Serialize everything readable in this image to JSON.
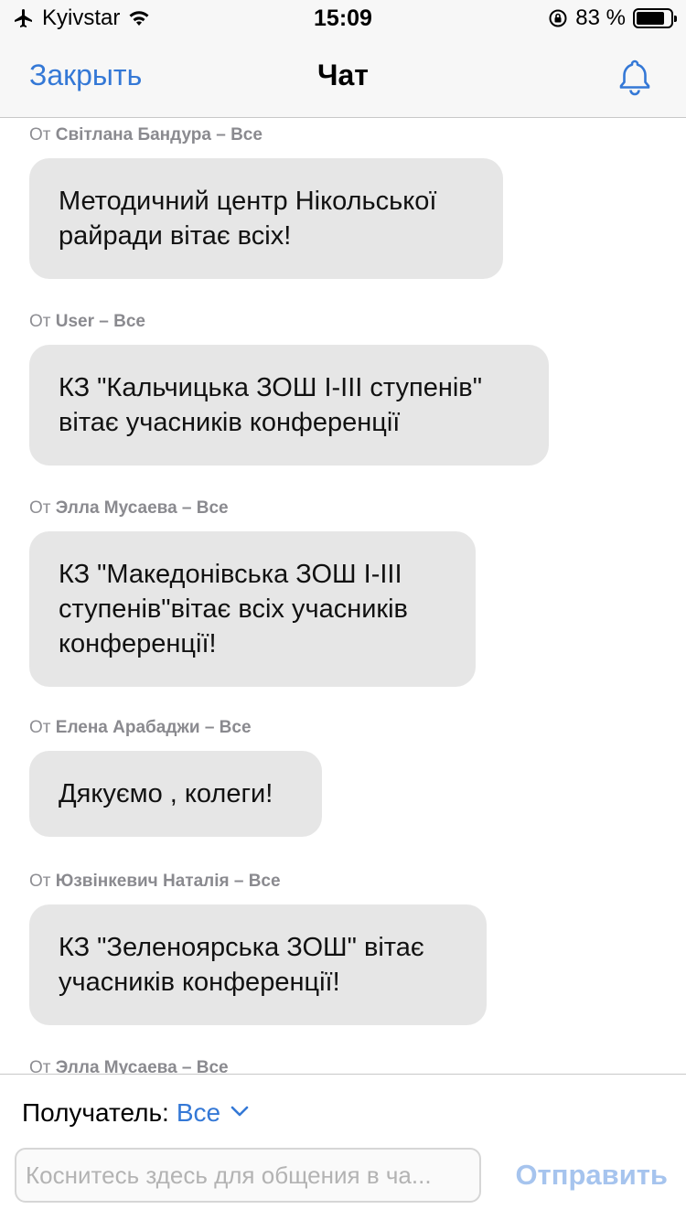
{
  "status_bar": {
    "carrier": "Kyivstar",
    "time": "15:09",
    "battery": "83 %",
    "battery_level": 0.83,
    "icons": [
      "airplane-icon",
      "wifi-icon",
      "orientation-lock-icon",
      "battery-icon"
    ]
  },
  "nav": {
    "close_label": "Закрыть",
    "title": "Чат",
    "bell_icon": "bell-icon"
  },
  "messages": [
    {
      "from_prefix": "От",
      "sender": "Світлана Бандура – Все",
      "text": "Методичний центр Нікольської райради вітає всіх!"
    },
    {
      "from_prefix": "От",
      "sender": "User – Все",
      "text": "КЗ \"Кальчицька ЗОШ I-III ступенів\" вітає учасників конференції"
    },
    {
      "from_prefix": "От",
      "sender": "Элла Мусаева – Все",
      "text": "КЗ \"Македонівська ЗОШ I-III ступенів\"вітає всіх учасників конференції!"
    },
    {
      "from_prefix": "От",
      "sender": "Елена Арабаджи – Все",
      "text": "Дякуємо , колеги!"
    },
    {
      "from_prefix": "От",
      "sender": "Юзвінкевич Наталія – Все",
      "text": "КЗ \"Зеленоярська ЗОШ\" вітає учасників конференції!"
    },
    {
      "from_prefix": "От",
      "sender": "Элла Мусаева – Все",
      "text": ""
    }
  ],
  "composer": {
    "recipient_label": "Получатель:",
    "recipient_value": "Все",
    "input_placeholder": "Коснитесь здесь для общения в ча...",
    "send_label": "Отправить"
  },
  "colors": {
    "accent": "#3478d6",
    "bubble": "#e6e6e6",
    "send_disabled": "#a6c4ee"
  }
}
